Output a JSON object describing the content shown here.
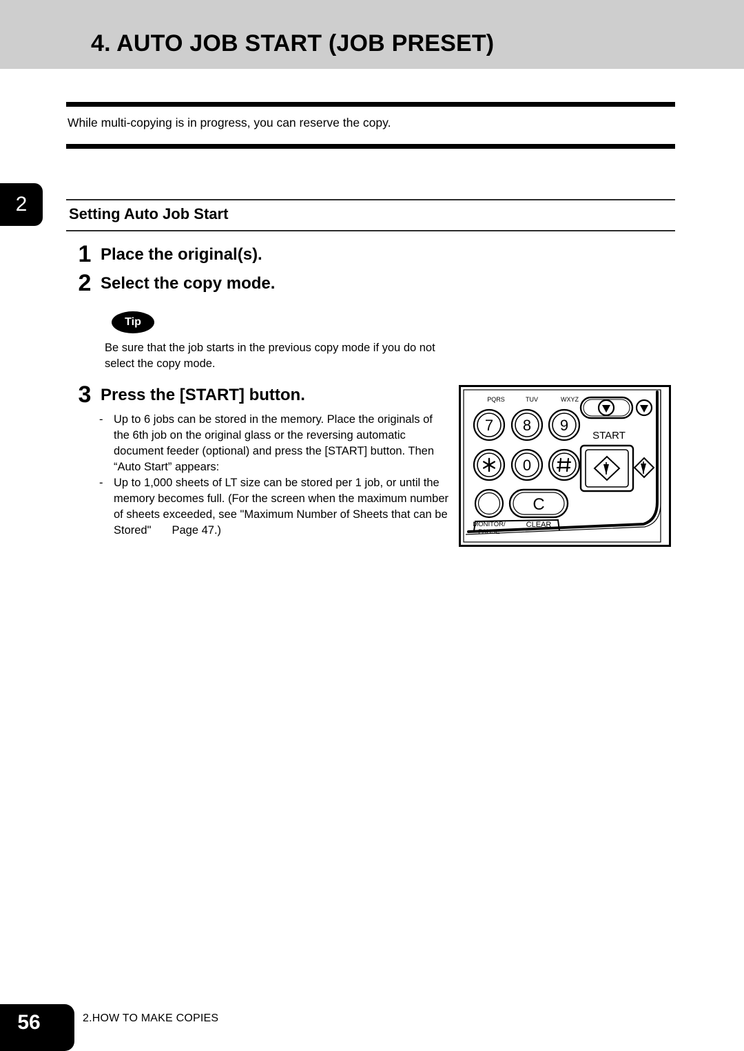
{
  "page": {
    "header_title": "4. AUTO JOB START (JOB PRESET)",
    "intro_text": "While multi-copying is in progress, you can reserve the copy.",
    "chapter_tab_number": "2",
    "footer_page_number": "56",
    "footer_chapter_label": "2.HOW TO MAKE COPIES",
    "header_band_color": "#cecece"
  },
  "section": {
    "title": "Setting Auto Job Start",
    "steps": [
      {
        "number": "1",
        "text": "Place the original(s)."
      },
      {
        "number": "2",
        "text": "Select the copy mode."
      },
      {
        "number": "3",
        "text": "Press the [START] button."
      }
    ]
  },
  "tip": {
    "badge_label": "Tip",
    "body": "Be sure that the job starts in the previous copy mode if you do not select the copy mode."
  },
  "notes": {
    "dash": "-",
    "items": [
      {
        "text_before": "Up to 6 jobs can be stored in the memory. Place the originals of the 6th job on the original glass or the reversing automatic document feeder (optional) and press the [START] button. Then “Auto Start” appears:",
        "text_after": ""
      },
      {
        "text_before": "Up to 1,000 sheets of LT size can be stored per 1 job, or until the memory becomes full. (For the screen when the maximum number of sheets exceeded, see \"Maximum Number of Sheets that can be Stored\"",
        "text_after": "Page 47.)"
      }
    ]
  },
  "control_panel": {
    "keypad": [
      {
        "key": "7",
        "letters": "PQRS"
      },
      {
        "key": "8",
        "letters": "TUV"
      },
      {
        "key": "9",
        "letters": "WXYZ"
      },
      {
        "key": "✱",
        "letters": ""
      },
      {
        "key": "0",
        "letters": ""
      },
      {
        "key": "#",
        "letters": ""
      }
    ],
    "clear_label": "CLEAR",
    "clear_key": "C",
    "monitor_label_line1": "MONITOR/",
    "monitor_label_line2": "PAUSE",
    "start_label": "START"
  }
}
